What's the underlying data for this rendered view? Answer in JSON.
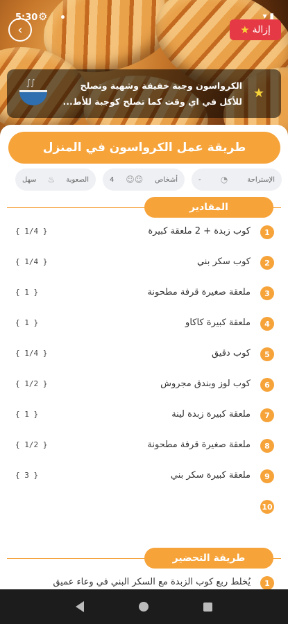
{
  "status_bar": {
    "time": "5:30"
  },
  "header": {
    "remove_label": "إزالة"
  },
  "banner": {
    "text": "الكرواسون وجبة خفيفة وشهية وتصلح للأكل في اي وقت كما تصلح كوجبة للأط..."
  },
  "recipe": {
    "title": "طريقة عمل الكرواسون في المنزل",
    "info": {
      "rest_label": "الإستراحة",
      "rest_value": "-",
      "persons_label": "أشخاص",
      "persons_value": "4",
      "difficulty_label": "الصعوبة",
      "difficulty_value": "سهل"
    }
  },
  "ingredients": {
    "heading": "المقادير",
    "items": [
      {
        "num": "1",
        "name": "كوب زبدة + 2 ملعقة كبيرة",
        "qty": "{ 1/4 }"
      },
      {
        "num": "2",
        "name": "كوب سكر بني",
        "qty": "{ 1/4 }"
      },
      {
        "num": "3",
        "name": "ملعقة صغيرة قرفة مطحونة",
        "qty": "{ 1 }"
      },
      {
        "num": "4",
        "name": "ملعقة كبيرة كاكاو",
        "qty": "{ 1 }"
      },
      {
        "num": "5",
        "name": "كوب دقيق",
        "qty": "{ 1/4 }"
      },
      {
        "num": "6",
        "name": "كوب لوز وبندق مجروش",
        "qty": "{ 1/2 }"
      },
      {
        "num": "7",
        "name": "ملعقة كبيرة زبدة لينة",
        "qty": "{ 1 }"
      },
      {
        "num": "8",
        "name": "ملعقة صغيرة قرفة مطحونة",
        "qty": "{ 1/2 }"
      },
      {
        "num": "9",
        "name": "ملعقة كبيرة سكر بني",
        "qty": "{ 3 }"
      },
      {
        "num": "10",
        "name": "",
        "qty": ""
      }
    ]
  },
  "preparation": {
    "heading": "طريقة التحضير",
    "first_step_num": "1",
    "first_step": "يُخلط ربع كوب الزبدة مع السكر البني في وعاء عميق"
  },
  "colors": {
    "accent": "#f6a33a",
    "remove": "#e53945",
    "navbar": "#1c1c1c"
  }
}
